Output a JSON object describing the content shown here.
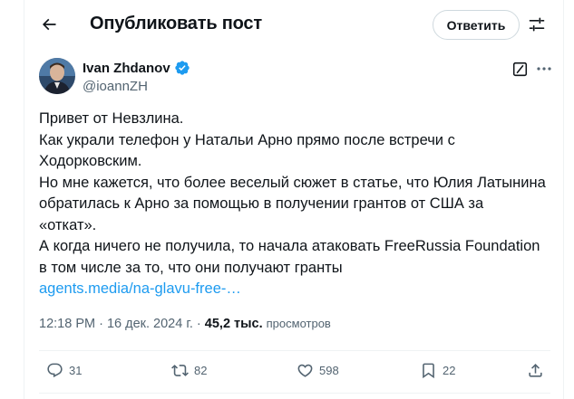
{
  "header": {
    "back_icon": "arrow-left-icon",
    "title": "Опубликовать пост",
    "reply_button": "Ответить",
    "filter_icon": "sliders-icon"
  },
  "author": {
    "name": "Ivan Zhdanov",
    "handle": "@ioannZH",
    "verified_icon": "verified-badge-icon",
    "verified_color": "#1d9bf0"
  },
  "tweet": {
    "lines": [
      "Привет от Невзлина.",
      "Как украли телефон у Натальи Арно прямо после встречи с",
      "Ходорковским.",
      "Но мне кажется, что более веселый сюжет в статье, что Юлия Латынина",
      "обратилась к Арно за помощью в получении  грантов от США за",
      "«откат».",
      "А когда ничего не получила, то начала атаковать FreeRussia Foundation",
      "в том числе за то, что они получают гранты"
    ],
    "link": "agents.media/na-glavu-free-…",
    "link_color": "#1d9bf0"
  },
  "meta": {
    "time": "12:18 PM",
    "separator": " · ",
    "date": "16 дек. 2024 г.",
    "views_count": "45,2 тыс.",
    "views_label": "просмотров"
  },
  "actions": {
    "replies": "31",
    "reposts": "82",
    "likes": "598",
    "bookmarks": "22"
  }
}
